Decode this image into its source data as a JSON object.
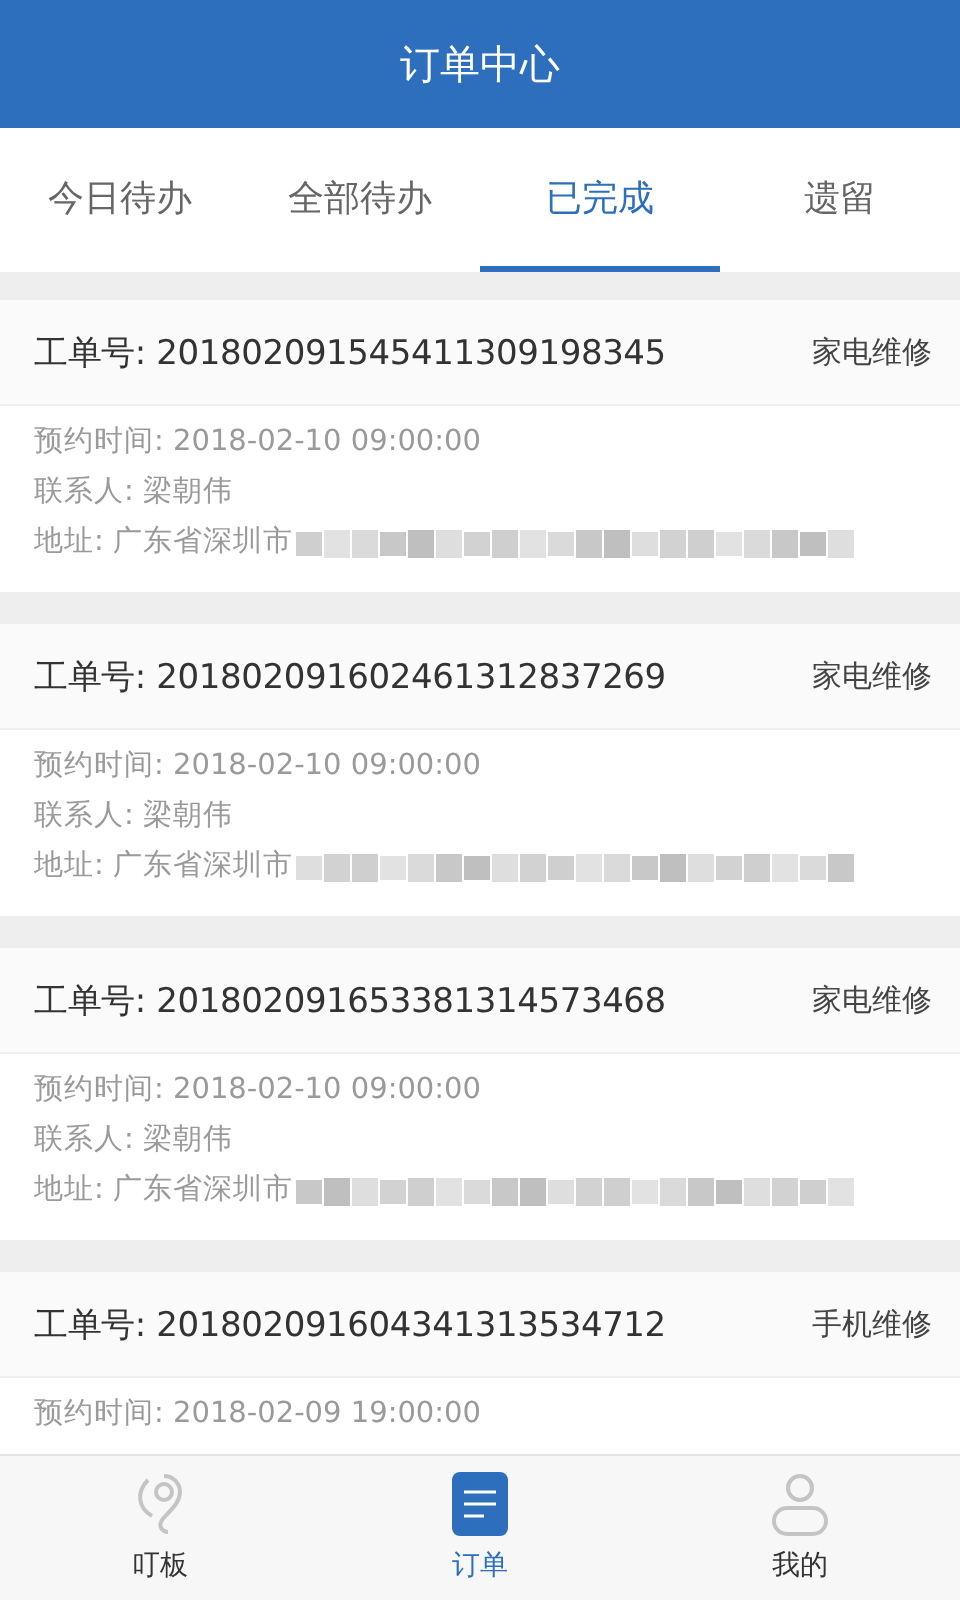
{
  "header": {
    "title": "订单中心"
  },
  "tabs": [
    {
      "label": "今日待办",
      "selected": false
    },
    {
      "label": "全部待办",
      "selected": false
    },
    {
      "label": "已完成",
      "selected": true
    },
    {
      "label": "遗留",
      "selected": false
    }
  ],
  "orders": [
    {
      "order_no": "工单号: 201802091545411309198345",
      "category": "家电维修",
      "appointment": "预约时间: 2018-02-10 09:00:00",
      "contact": "联系人: 梁朝伟",
      "address": "地址: 广东省深圳市",
      "address_redacted": true
    },
    {
      "order_no": "工单号: 201802091602461312837269",
      "category": "家电维修",
      "appointment": "预约时间: 2018-02-10 09:00:00",
      "contact": "联系人: 梁朝伟",
      "address": "地址: 广东省深圳市",
      "address_redacted": true
    },
    {
      "order_no": "工单号: 201802091653381314573468",
      "category": "家电维修",
      "appointment": "预约时间: 2018-02-10 09:00:00",
      "contact": "联系人: 梁朝伟",
      "address": "地址: 广东省深圳市",
      "address_redacted": true
    },
    {
      "order_no": "工单号: 201802091604341313534712",
      "category": "手机维修",
      "appointment": "预约时间: 2018-02-09 19:00:00"
    }
  ],
  "bottom_nav": [
    {
      "label": "叮板",
      "kind": "board",
      "selected": false
    },
    {
      "label": "订单",
      "kind": "orders",
      "selected": true
    },
    {
      "label": "我的",
      "kind": "profile",
      "selected": false
    }
  ]
}
